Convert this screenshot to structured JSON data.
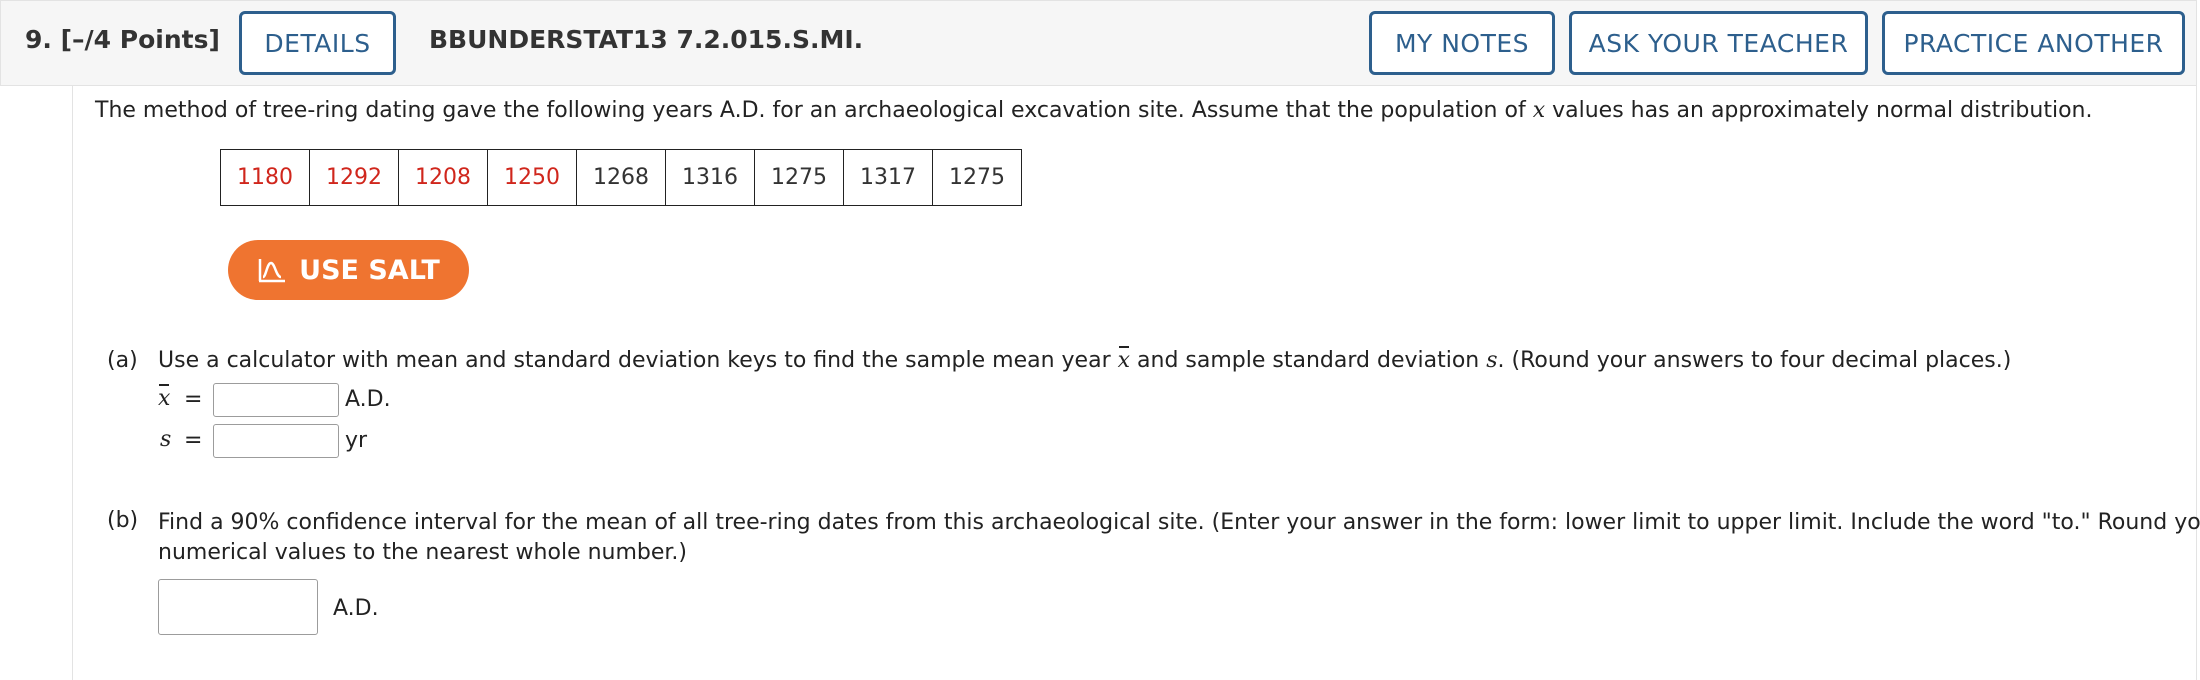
{
  "header": {
    "question_number": "9.",
    "points": "[–/4 Points]",
    "details_label": "DETAILS",
    "question_id": "BBUNDERSTAT13 7.2.015.S.MI.",
    "my_notes_label": "MY NOTES",
    "ask_teacher_label": "ASK YOUR TEACHER",
    "practice_another_label": "PRACTICE ANOTHER"
  },
  "problem": {
    "intro_before_x": "The method of tree-ring dating gave the following years A.D. for an archaeological excavation site. Assume that the population of ",
    "x_var": "x",
    "intro_after_x": " values has an approximately normal distribution.",
    "years": [
      "1180",
      "1292",
      "1208",
      "1250",
      "1268",
      "1316",
      "1275",
      "1317",
      "1275"
    ],
    "year_colors": [
      "red",
      "red",
      "red",
      "red",
      "dark",
      "dark",
      "dark",
      "dark",
      "dark"
    ]
  },
  "salt_button": {
    "label": "USE SALT",
    "icon": "salt-chart-icon",
    "color": "#ef7430"
  },
  "part_a": {
    "label": "(a)",
    "text_before_xbar": "Use a calculator with mean and standard deviation keys to find the sample mean year ",
    "xbar": "x",
    "text_mid": " and sample standard deviation ",
    "s_var": "s",
    "text_after": ". (Round your answers to four decimal places.)",
    "xbar_field": {
      "var": "x",
      "equals": "=",
      "value": "",
      "unit": "A.D."
    },
    "s_field": {
      "var": "s",
      "equals": "=",
      "value": "",
      "unit": "yr"
    }
  },
  "part_b": {
    "label": "(b)",
    "line1": "Find a 90% confidence interval for the mean of all tree-ring dates from this archaeological site. (Enter your answer in the form: lower limit to upper limit. Include the word \"to.\" Round your",
    "line2": "numerical values to the nearest whole number.)",
    "answer_value": "",
    "unit": "A.D."
  },
  "colors": {
    "accent_blue": "#2d5f8d",
    "data_red": "#d0261c",
    "salt_orange": "#ef7430"
  }
}
